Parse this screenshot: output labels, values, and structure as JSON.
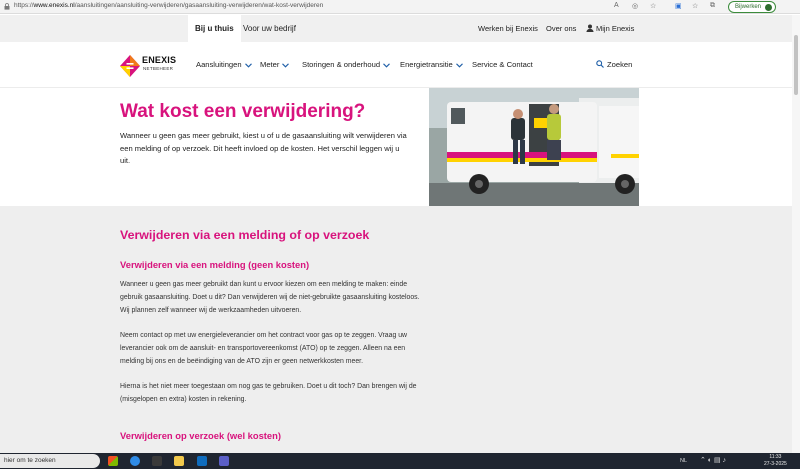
{
  "browser": {
    "url_prefix": "https://",
    "url_domain": "www.enexis.nl",
    "url_path": "/aansluitingen/aansluiting-verwijderen/gasaansluiting-verwijderen/wat-kost-verwijderen",
    "update_label": "Bijwerken"
  },
  "topbar": {
    "tabs": [
      {
        "label": "Bij u thuis"
      },
      {
        "label": "Voor uw bedrijf"
      }
    ],
    "links": [
      {
        "label": "Werken bij Enexis"
      },
      {
        "label": "Over ons"
      },
      {
        "label": "Mijn Enexis"
      }
    ]
  },
  "header": {
    "logo_name": "ENEXIS",
    "logo_sub": "NETBEHEER",
    "nav": [
      {
        "label": "Aansluitingen"
      },
      {
        "label": "Meter"
      },
      {
        "label": "Storingen & onderhoud"
      },
      {
        "label": "Energietransitie"
      },
      {
        "label": "Service & Contact"
      }
    ],
    "search_label": "Zoeken"
  },
  "hero": {
    "title": "Wat kost een verwijdering?",
    "intro": "Wanneer u geen gas meer gebruikt, kiest u of u de gasaansluiting wilt verwijderen via een melding of op verzoek. Dit heeft invloed op de kosten. Het verschil leggen wij u uit."
  },
  "content": {
    "heading": "Verwijderen via een melding of op verzoek",
    "sub1": "Verwijderen via een melding (geen kosten)",
    "p1": "Wanneer u geen gas meer gebruikt dan kunt u ervoor kiezen om een melding te maken: einde gebruik gasaansluiting. Doet u dit? Dan verwijderen wij de niet-gebruikte gasaansluiting kosteloos. Wij plannen zelf wanneer wij de werkzaamheden uitvoeren.",
    "p2": "Neem contact op met uw energieleverancier om het contract voor gas op te zeggen. Vraag uw leverancier ook om de aansluit- en transportovereenkomst (ATO) op te zeggen. Alleen na een melding bij ons en de beëindiging van de ATO zijn er geen netwerkkosten meer.",
    "p3": "Hierna is het niet meer toegestaan om nog gas te gebruiken. Doet u dit toch? Dan brengen wij de (misgelopen en extra) kosten in rekening.",
    "sub2": "Verwijderen op verzoek (wel kosten)"
  },
  "taskbar": {
    "search_placeholder": "hier om te zoeken",
    "lang": "NL",
    "time": "11:33",
    "date": "27-3-2025"
  },
  "colors": {
    "brand_magenta": "#d8137d",
    "link_blue": "#1f5fa8",
    "gray_bg": "#eeeeee"
  }
}
